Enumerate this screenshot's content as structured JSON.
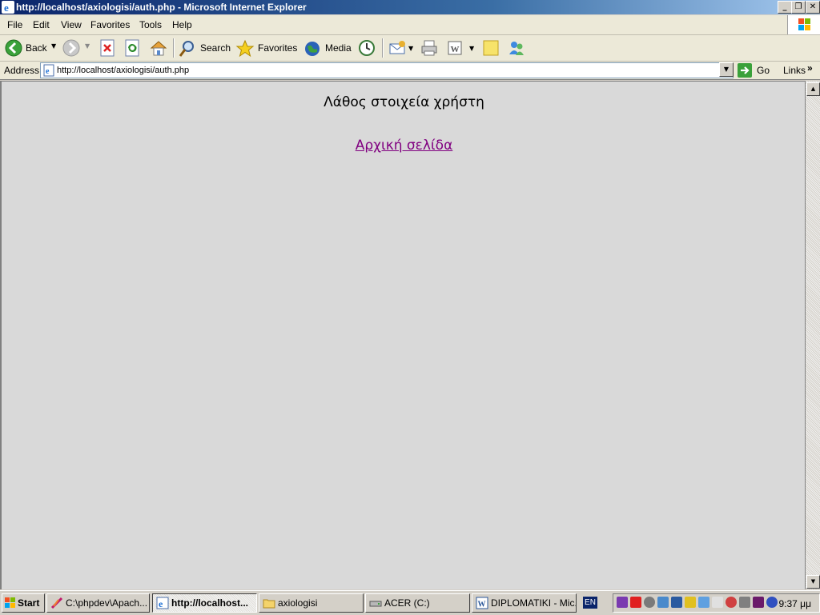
{
  "window": {
    "title": "http://localhost/axiologisi/auth.php - Microsoft Internet Explorer",
    "controls": {
      "minimize": "_",
      "maximize": "❐",
      "close": "✕"
    }
  },
  "menu": {
    "items": [
      "File",
      "Edit",
      "View",
      "Favorites",
      "Tools",
      "Help"
    ]
  },
  "toolbar": {
    "back_label": "Back",
    "search_label": "Search",
    "favorites_label": "Favorites",
    "media_label": "Media"
  },
  "address": {
    "label": "Address",
    "url": "http://localhost/axiologisi/auth.php",
    "go_label": "Go",
    "links_label": "Links",
    "links_chevron": "»"
  },
  "page": {
    "heading": "Λάθος στοιχεία χρήστη",
    "home_link": "Αρχική σελίδα",
    "link_color": "#800080",
    "background": "#d9d9d9"
  },
  "taskbar": {
    "start_label": "Start",
    "tasks": [
      {
        "label": "C:\\phpdev\\Apach...",
        "icon": "feather-icon",
        "active": false
      },
      {
        "label": "http://localhost...",
        "icon": "ie-icon",
        "active": true
      },
      {
        "label": "axiologisi",
        "icon": "folder-icon",
        "active": false
      },
      {
        "label": "ACER (C:)",
        "icon": "drive-icon",
        "active": false
      },
      {
        "label": "DIPLOMATIKI - Mic...",
        "icon": "word-icon",
        "active": false
      }
    ],
    "language": "EN",
    "clock": "9:37 μμ"
  }
}
